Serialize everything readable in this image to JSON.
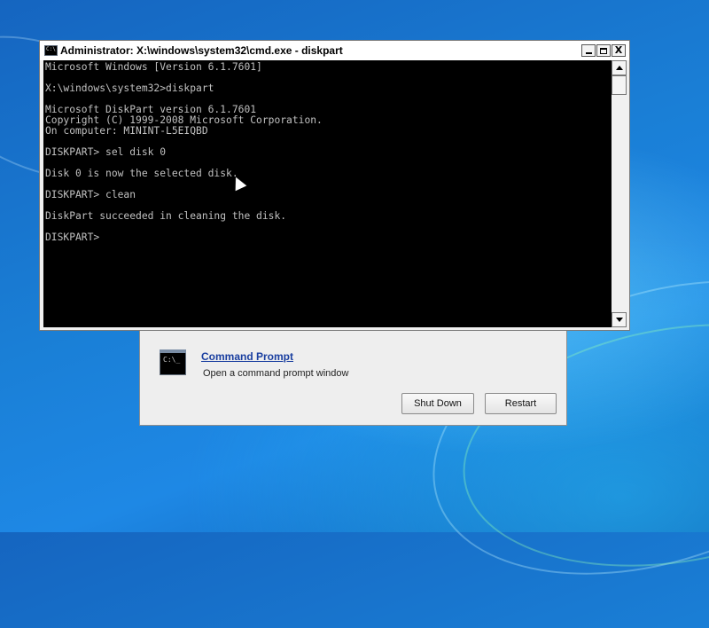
{
  "window": {
    "title": "Administrator: X:\\windows\\system32\\cmd.exe - diskpart",
    "controls": {
      "minimize": "_",
      "maximize": "□",
      "close": "X"
    }
  },
  "console": {
    "lines": [
      "Microsoft Windows [Version 6.1.7601]",
      "",
      "X:\\windows\\system32>diskpart",
      "",
      "Microsoft DiskPart version 6.1.7601",
      "Copyright (C) 1999-2008 Microsoft Corporation.",
      "On computer: MININT-L5EIQBD",
      "",
      "DISKPART> sel disk 0",
      "",
      "Disk 0 is now the selected disk.",
      "",
      "DISKPART> clean",
      "",
      "DiskPart succeeded in cleaning the disk.",
      "",
      "DISKPART>"
    ]
  },
  "recovery": {
    "icon_text": "C:\\_",
    "link_label": "Command Prompt",
    "description": "Open a command prompt window",
    "buttons": {
      "shutdown": "Shut Down",
      "restart": "Restart"
    }
  },
  "colors": {
    "console_bg": "#000000",
    "console_fg": "#c0c0c0",
    "link": "#1a3fa0",
    "desktop": "#1a7fd6"
  }
}
